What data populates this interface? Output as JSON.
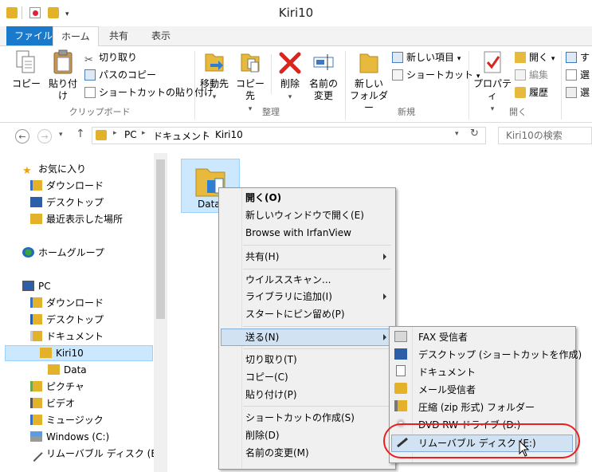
{
  "window": {
    "title": "Kiri10"
  },
  "ribbon_tabs": [
    "ファイル",
    "ホーム",
    "共有",
    "表示"
  ],
  "ribbon": {
    "clipboard": {
      "copy": "コピー",
      "paste": "貼り付け",
      "cut": "切り取り",
      "copy_path": "パスのコピー",
      "paste_shortcut": "ショートカットの貼り付け",
      "label": "クリップボード"
    },
    "organize": {
      "move_to": "移動先",
      "copy_to": "コピー先",
      "delete": "削除",
      "rename_1": "名前の",
      "rename_2": "変更",
      "label": "整理"
    },
    "new": {
      "new_folder_1": "新しい",
      "new_folder_2": "フォルダー",
      "new_item": "新しい項目",
      "shortcut": "ショートカット",
      "label": "新規"
    },
    "open": {
      "properties": "プロパティ",
      "open": "開く",
      "edit": "編集",
      "history": "履歴",
      "label": "開く"
    },
    "select": {
      "a": "す",
      "b": "選",
      "c": "選"
    }
  },
  "address": {
    "parts": [
      "PC",
      "ドキュメント",
      "Kiri10"
    ],
    "search_placeholder": "Kiri10の検索"
  },
  "nav": {
    "favorites": "お気に入り",
    "downloads": "ダウンロード",
    "desktop": "デスクトップ",
    "recent": "最近表示した場所",
    "homegroup": "ホームグループ",
    "pc": "PC",
    "pc_downloads": "ダウンロード",
    "pc_desktop": "デスクトップ",
    "pc_documents": "ドキュメント",
    "kiri10": "Kiri10",
    "data": "Data",
    "pictures": "ピクチャ",
    "video": "ビデオ",
    "music": "ミュージック",
    "windows_c": "Windows (C:)",
    "removable_e": "リムーバブル ディスク (E:)"
  },
  "file": {
    "name": "Data"
  },
  "context_menu": {
    "open": "開く(O)",
    "open_new_window": "新しいウィンドウで開く(E)",
    "irfanview": "Browse with IrfanView",
    "share": "共有(H)",
    "virus_scan": "ウイルススキャン...",
    "add_library": "ライブラリに追加(I)",
    "pin_start": "スタートにピン留め(P)",
    "send_to": "送る(N)",
    "cut": "切り取り(T)",
    "copy": "コピー(C)",
    "paste": "貼り付け(P)",
    "create_shortcut": "ショートカットの作成(S)",
    "delete": "削除(D)",
    "rename": "名前の変更(M)"
  },
  "send_to_menu": {
    "fax": "FAX 受信者",
    "desktop": "デスクトップ (ショートカットを作成)",
    "documents": "ドキュメント",
    "mail": "メール受信者",
    "zip": "圧縮 (zip 形式) フォルダー",
    "dvd": "DVD RW ドライブ (D:)",
    "removable": "リムーバブル ディスク (E:)"
  },
  "colors": {
    "file_tab": "#1979ca",
    "highlight": "#d1e2f2",
    "annotation": "#e8201f"
  }
}
